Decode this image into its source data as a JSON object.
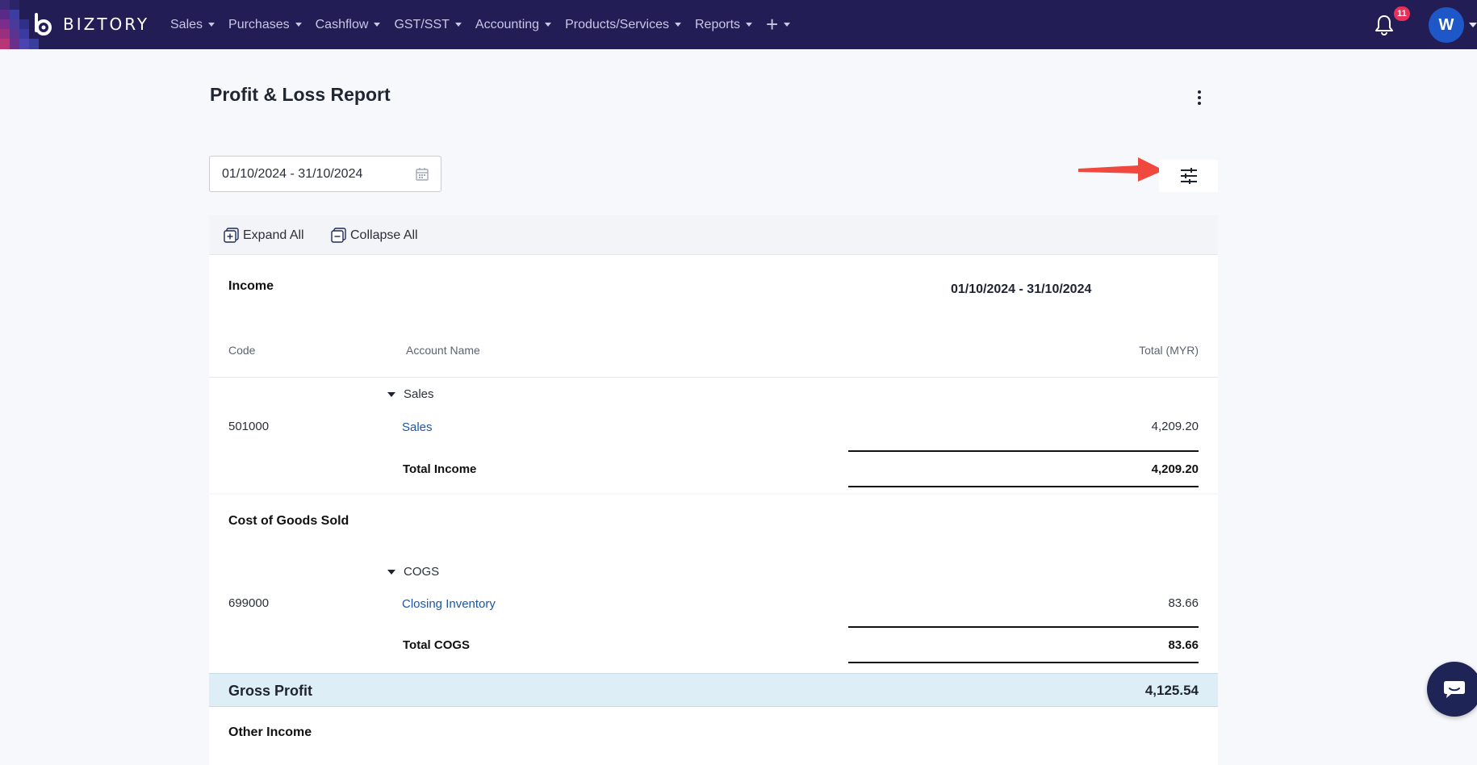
{
  "brand": {
    "name": "BIZTORY"
  },
  "nav": {
    "items": [
      {
        "label": "Sales"
      },
      {
        "label": "Purchases"
      },
      {
        "label": "Cashflow"
      },
      {
        "label": "GST/SST"
      },
      {
        "label": "Accounting"
      },
      {
        "label": "Products/Services"
      },
      {
        "label": "Reports"
      }
    ],
    "notifications_count": "11",
    "user_initial": "W"
  },
  "page": {
    "title": "Profit & Loss Report",
    "date_range": "01/10/2024 - 31/10/2024"
  },
  "toolbar": {
    "expand_all": "Expand All",
    "collapse_all": "Collapse All"
  },
  "report": {
    "period_header": "01/10/2024 - 31/10/2024",
    "columns": {
      "code": "Code",
      "account_name": "Account Name",
      "total": "Total (MYR)"
    },
    "income": {
      "title": "Income",
      "group": "Sales",
      "rows": [
        {
          "code": "501000",
          "account": "Sales",
          "amount": "4,209.20"
        }
      ],
      "total_label": "Total Income",
      "total_amount": "4,209.20"
    },
    "cogs": {
      "title": "Cost of Goods Sold",
      "group": "COGS",
      "rows": [
        {
          "code": "699000",
          "account": "Closing Inventory",
          "amount": "83.66"
        }
      ],
      "total_label": "Total COGS",
      "total_amount": "83.66"
    },
    "gross_profit": {
      "label": "Gross Profit",
      "amount": "4,125.54"
    },
    "other_income": {
      "title": "Other Income"
    }
  },
  "colors": {
    "nav_bg": "#231d56",
    "accent_link": "#1a57a8",
    "badge": "#e8305a",
    "avatar": "#1e57c8",
    "gross_profit_bg": "#ddeef6",
    "annotation_arrow": "#f0473e"
  },
  "icons": [
    "brand-logo-icon",
    "caret-down-icon",
    "plus-icon",
    "bell-icon",
    "kebab-menu-icon",
    "calendar-icon",
    "filter-sliders-icon",
    "expand-all-icon",
    "collapse-all-icon",
    "triangle-down-icon",
    "chat-icon",
    "red-arrow-annotation"
  ]
}
